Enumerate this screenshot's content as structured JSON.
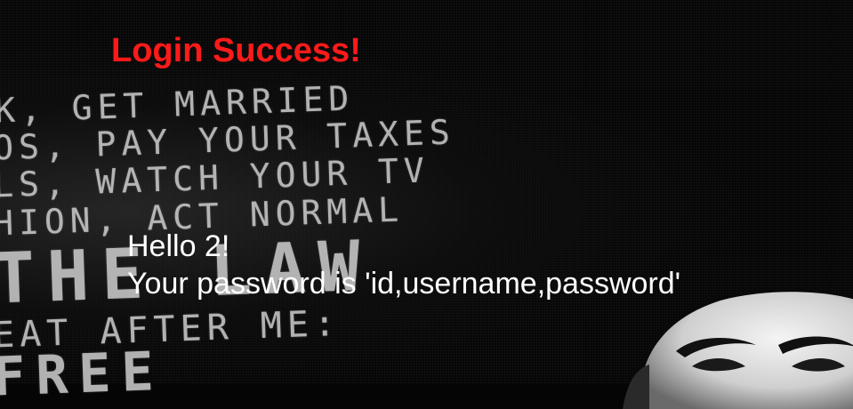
{
  "page": {
    "title": "Login Success!",
    "greeting": "Hello 2!",
    "password_message": "Your password is 'id,username,password'"
  },
  "background": {
    "poster_lines": [
      "K, GET MARRIED",
      "OS, PAY YOUR TAXES",
      "LS, WATCH YOUR TV",
      "HION, ACT NORMAL",
      "THE LAW",
      "EAT AFTER ME:",
      "FREE"
    ]
  },
  "colors": {
    "title": "#ff1a1a",
    "text": "#ffffff",
    "background": "#050505"
  }
}
